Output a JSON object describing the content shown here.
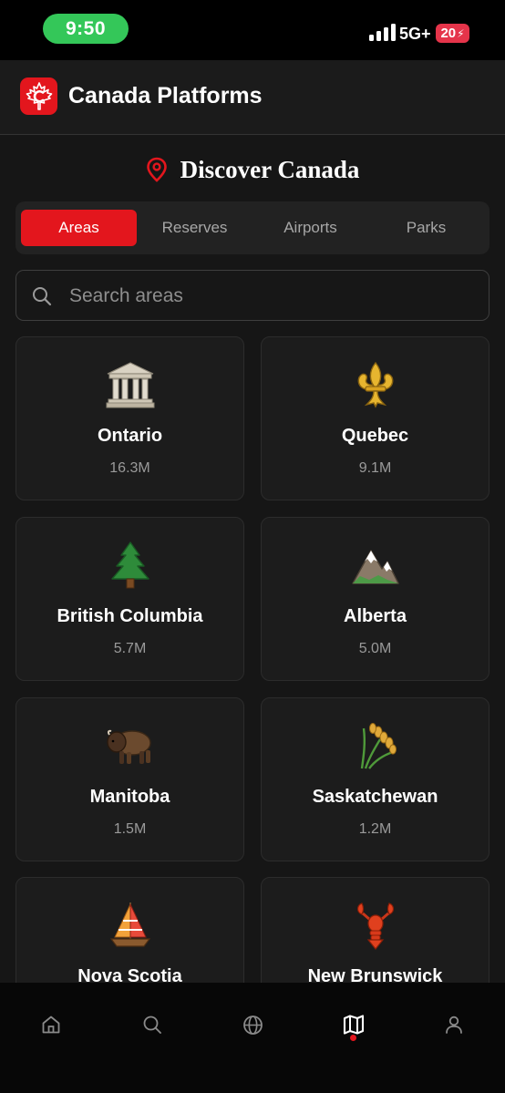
{
  "status_bar": {
    "time": "9:50",
    "network": "5G+",
    "battery": "20",
    "time_pill_color": "#34c759",
    "battery_color": "#e5344a"
  },
  "header": {
    "title": "Canada Platforms",
    "brand_color": "#e3161d",
    "logo_icon": "maple-leaf-icon"
  },
  "page": {
    "title": "Discover Canada",
    "title_icon": "location-pin-icon"
  },
  "tabs": [
    {
      "label": "Areas",
      "active": true
    },
    {
      "label": "Reserves",
      "active": false
    },
    {
      "label": "Airports",
      "active": false
    },
    {
      "label": "Parks",
      "active": false
    }
  ],
  "search": {
    "placeholder": "Search areas",
    "value": ""
  },
  "areas": [
    {
      "name": "Ontario",
      "population": "16.3M",
      "icon": "classical-building-icon"
    },
    {
      "name": "Quebec",
      "population": "9.1M",
      "icon": "fleur-de-lis-icon"
    },
    {
      "name": "British Columbia",
      "population": "5.7M",
      "icon": "evergreen-tree-icon"
    },
    {
      "name": "Alberta",
      "population": "5.0M",
      "icon": "snow-mountain-icon"
    },
    {
      "name": "Manitoba",
      "population": "1.5M",
      "icon": "bison-icon"
    },
    {
      "name": "Saskatchewan",
      "population": "1.2M",
      "icon": "wheat-sheaf-icon"
    },
    {
      "name": "Nova Scotia",
      "population": "",
      "icon": "sailboat-icon"
    },
    {
      "name": "New Brunswick",
      "population": "",
      "icon": "lobster-icon"
    }
  ],
  "bottom_nav": {
    "items": [
      {
        "icon": "home-icon",
        "active": false
      },
      {
        "icon": "search-icon",
        "active": false
      },
      {
        "icon": "globe-icon",
        "active": false
      },
      {
        "icon": "map-icon",
        "active": true
      },
      {
        "icon": "profile-icon",
        "active": false
      }
    ],
    "active_color": "#e3161d"
  }
}
